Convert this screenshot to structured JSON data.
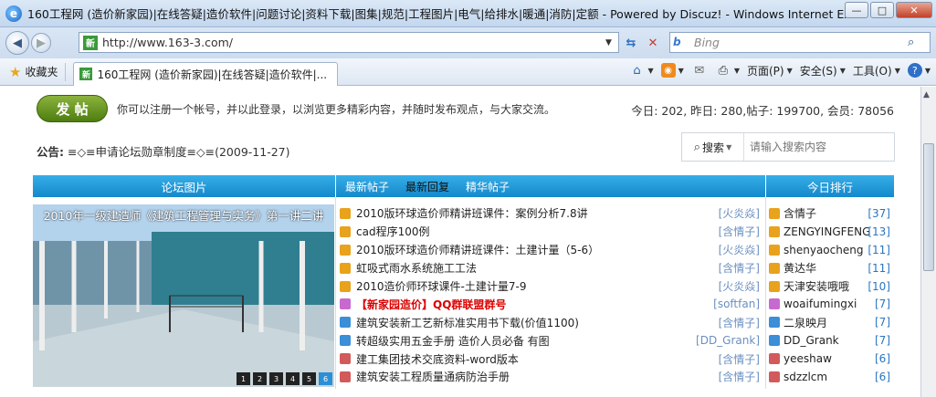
{
  "window": {
    "title": "160工程网 (造价新家园)|在线答疑|造价软件|问题讨论|资料下载|图集|规范|工程图片|电气|给排水|暖通|消防|定额 - Powered by Discuz! - Windows Internet Explorer",
    "min_label": "—",
    "max_label": "□",
    "close_label": "✕"
  },
  "address": {
    "url": "http://www.163-3.com/",
    "search_placeholder": "Bing"
  },
  "favbar": {
    "favorites_label": "收藏夹",
    "tab_title": "160工程网 (造价新家园)|在线答疑|造价软件|...",
    "menu_page": "页面(P)",
    "menu_safety": "安全(S)",
    "menu_tools": "工具(O)"
  },
  "forum": {
    "post_button": "发 帖",
    "intro": "你可以注册一个帐号，并以此登录，以浏览更多精彩内容，并随时发布观点，与大家交流。",
    "stats": "今日: 202, 昨日: 280,帖子: 199700, 会员: 78056",
    "notice_label": "公告:",
    "notice_text": "≡◇≡申请论坛勋章制度≡◇≡(2009-11-27)",
    "search_select": "搜索",
    "search_placeholder": "请输入搜索内容"
  },
  "panels": {
    "photos_header": "论坛图片",
    "tab_latest": "最新帖子",
    "tab_replies": "最新回复",
    "tab_essence": "精华帖子",
    "rank_header": "今日排行"
  },
  "slideshow": {
    "caption": "2010年一级建造师《建筑工程管理与实务》第一讲二讲",
    "pages": [
      "1",
      "2",
      "3",
      "4",
      "5",
      "6"
    ],
    "active_page": "6"
  },
  "posts": [
    {
      "title": "2010版环球造价师精讲班课件：案例分析7.8讲",
      "author": "[火炎焱]",
      "color": "#e8a21c",
      "red": false
    },
    {
      "title": "cad程序100例",
      "author": "[含情子]",
      "color": "#e8a21c",
      "red": false
    },
    {
      "title": "2010版环球造价师精讲班课件：土建计量（5-6）",
      "author": "[火炎焱]",
      "color": "#e8a21c",
      "red": false
    },
    {
      "title": "虹吸式雨水系统施工工法",
      "author": "[含情子]",
      "color": "#e8a21c",
      "red": false
    },
    {
      "title": "2010造价师环球课件-土建计量7-9",
      "author": "[火炎焱]",
      "color": "#e8a21c",
      "red": false
    },
    {
      "title": "【新家园造价】QQ群联盟群号",
      "author": "[softfan]",
      "color": "#c76ad0",
      "red": true
    },
    {
      "title": "建筑安装新工艺新标准实用书下载(价值1100)",
      "author": "[含情子]",
      "color": "#3b8ed8",
      "red": false
    },
    {
      "title": "转超级实用五金手册 造价人员必备 有图",
      "author": "[DD_Grank]",
      "color": "#3b8ed8",
      "red": false
    },
    {
      "title": "建工集团技术交底资料-word版本",
      "author": "[含情子]",
      "color": "#d25a5a",
      "red": false
    },
    {
      "title": "建筑安装工程质量通病防治手册",
      "author": "[含情子]",
      "color": "#d25a5a",
      "red": false
    }
  ],
  "ranking": [
    {
      "name": "含情子",
      "count": "[37]",
      "color": "#e8a21c"
    },
    {
      "name": "ZENGYINGFENG",
      "count": "[13]",
      "color": "#e8a21c"
    },
    {
      "name": "shenyaocheng",
      "count": "[11]",
      "color": "#e8a21c"
    },
    {
      "name": "黄达华",
      "count": "[11]",
      "color": "#e8a21c"
    },
    {
      "name": "天津安装哦哦",
      "count": "[10]",
      "color": "#e8a21c"
    },
    {
      "name": "woaifumingxi",
      "count": "[7]",
      "color": "#c76ad0"
    },
    {
      "name": "二泉映月",
      "count": "[7]",
      "color": "#3b8ed8"
    },
    {
      "name": "DD_Grank",
      "count": "[7]",
      "color": "#3b8ed8"
    },
    {
      "name": "yeeshaw",
      "count": "[6]",
      "color": "#d25a5a"
    },
    {
      "name": "sdzzlcm",
      "count": "[6]",
      "color": "#d25a5a"
    }
  ]
}
